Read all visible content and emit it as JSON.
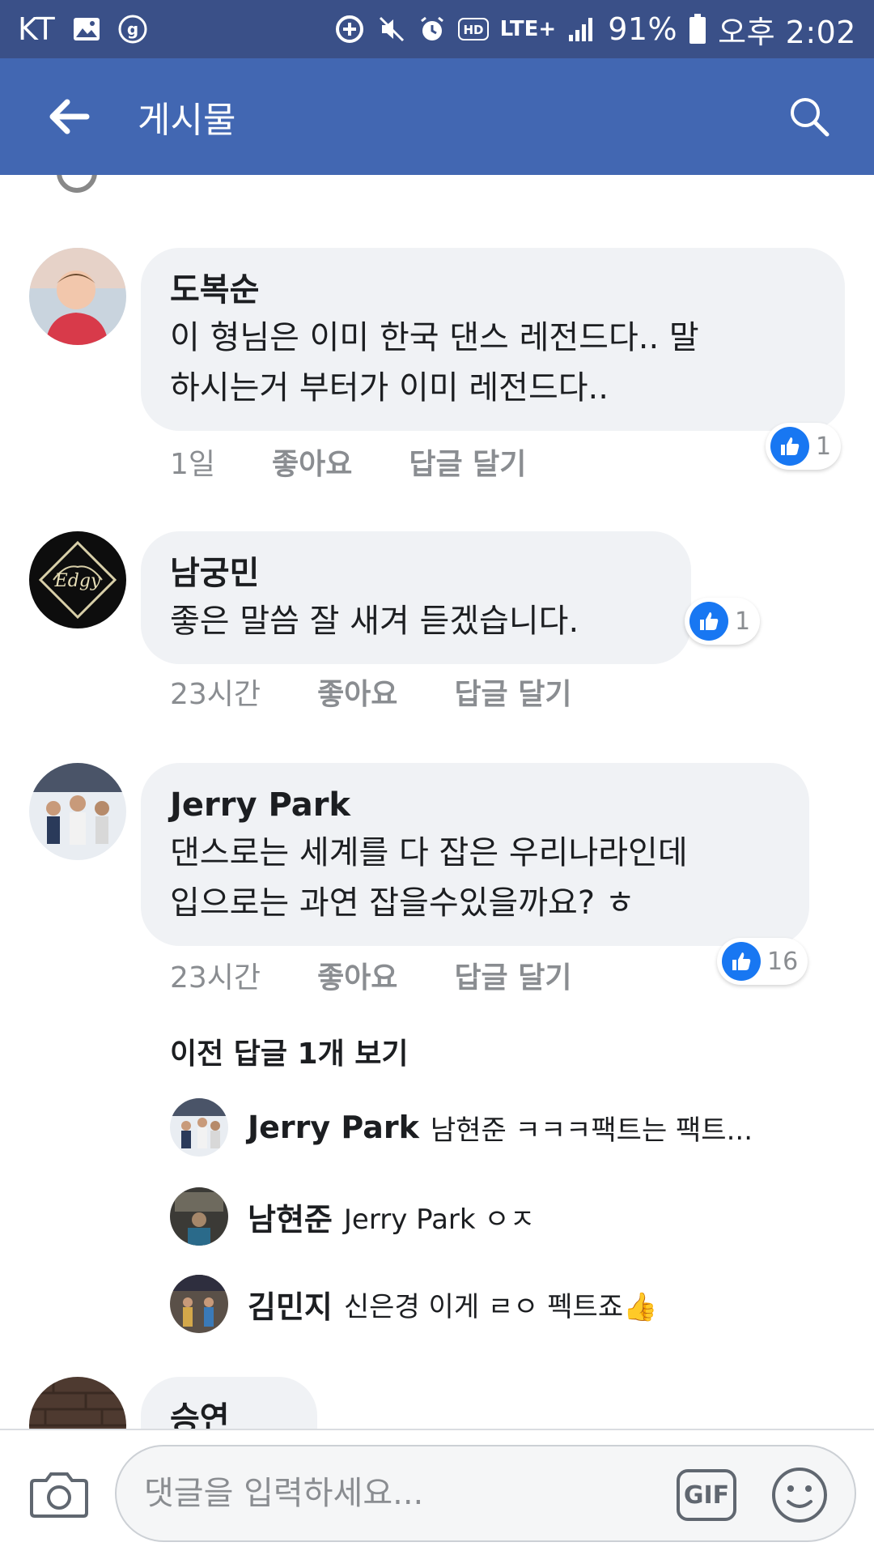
{
  "status_bar": {
    "carrier": "KT",
    "network": "LTE+",
    "battery": "91%",
    "time": "오후 2:02",
    "icons": [
      "image-icon",
      "g-icon",
      "data-saver-icon",
      "mute-icon",
      "alarm-icon",
      "hd-icon",
      "signal-icon",
      "battery-icon"
    ]
  },
  "app_bar": {
    "title": "게시물",
    "icons": [
      "back-arrow-icon",
      "search-icon"
    ]
  },
  "comments": [
    {
      "name": "도복순",
      "text_line1": "이 형님은 이미 한국 댄스 레전드다.. 말",
      "text_line2": "하시는거 부터가 이미 레전드다..",
      "time": "1일",
      "like_label": "좋아요",
      "reply_label": "답글 달기",
      "reactions": "1"
    },
    {
      "name": "남궁민",
      "text_line1": "좋은 말씀 잘 새겨 듣겠습니다.",
      "time": "23시간",
      "like_label": "좋아요",
      "reply_label": "답글 달기",
      "reactions": "1"
    },
    {
      "name": "Jerry Park",
      "text_line1": "댄스로는 세계를 다 잡은 우리나라인데",
      "text_line2": "입으로는 과연 잡을수있을까요? ㅎ",
      "time": "23시간",
      "like_label": "좋아요",
      "reply_label": "답글 달기",
      "reactions": "16"
    },
    {
      "name": "승연"
    }
  ],
  "previous_replies_label": "이전 답글 1개 보기",
  "replies": [
    {
      "name": "Jerry Park",
      "text": "남현준 ㅋㅋㅋ팩트는 팩트..."
    },
    {
      "name": "남현준",
      "text": "Jerry Park ㅇㅈ"
    },
    {
      "name": "김민지",
      "text": "신은경 이게 ㄹㅇ 펙트죠👍"
    }
  ],
  "composer": {
    "placeholder": "댓글을 입력하세요...",
    "gif_label": "GIF",
    "icons": [
      "camera-icon",
      "emoji-icon"
    ]
  },
  "colors": {
    "status_bar": "#3a5088",
    "app_bar": "#4267b2",
    "bubble": "#f0f2f5",
    "like_blue": "#1877f2",
    "meta_gray": "#8a8d91"
  }
}
